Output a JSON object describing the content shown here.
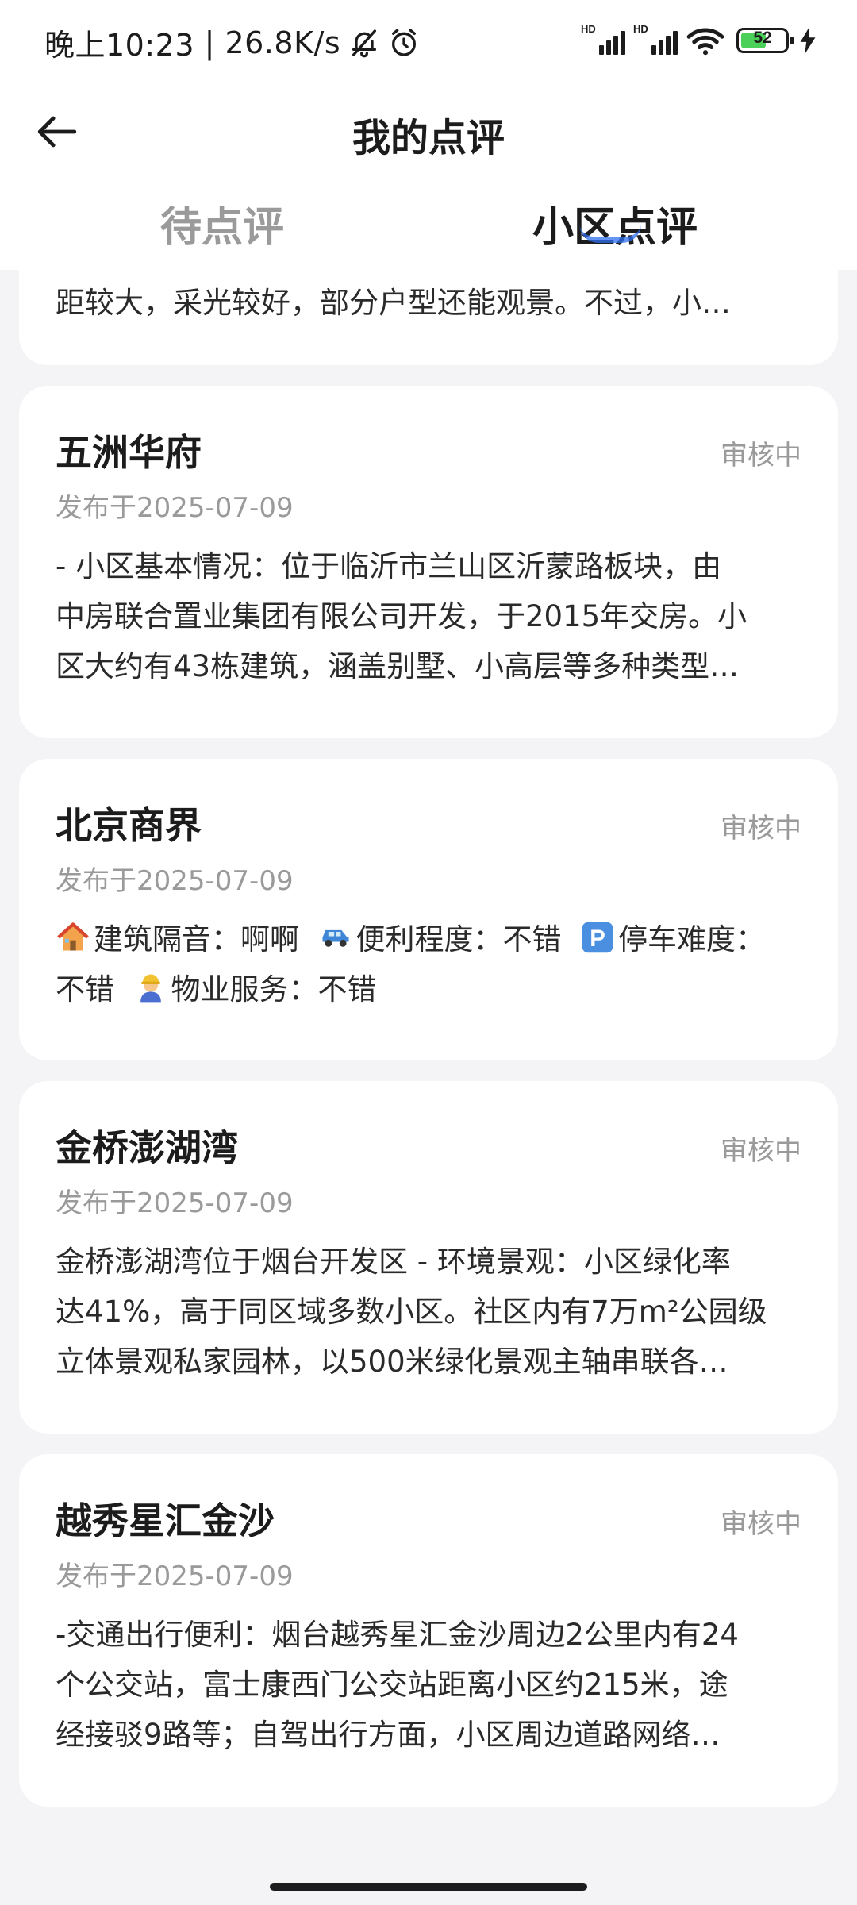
{
  "status_bar": {
    "time": "晚上10:23",
    "network_speed": "26.8K/s",
    "sim1_label": "HD",
    "sim2_label": "HD",
    "battery_level": "52",
    "icons": [
      "bell-off-icon",
      "alarm-clock-icon",
      "signal-icon",
      "wifi-icon",
      "battery-icon",
      "charging-icon"
    ]
  },
  "header": {
    "title": "我的点评",
    "back_icon": "arrow-left-icon"
  },
  "tabs": [
    {
      "label": "待点评",
      "active": false
    },
    {
      "label": "小区点评",
      "active": true
    }
  ],
  "colors": {
    "accent": "#2f6ff0",
    "background": "#f4f4f6",
    "card": "#ffffff",
    "muted": "#9a9a9a",
    "text": "#1c1c1c"
  },
  "partial_card": {
    "excerpt": "距较大，采光较好，部分户型还能观景。不过，小…"
  },
  "reviews": [
    {
      "title": "五洲华府",
      "status": "审核中",
      "date": "发布于2025-07-09",
      "lines": [
        "- 小区基本情况：位于临沂市兰山区沂蒙路板块，由",
        "中房联合置业集团有限公司开发，于2015年交房。小",
        "区大约有43栋建筑，涵盖别墅、小高层等多种类型…"
      ]
    },
    {
      "title": "北京商界",
      "status": "审核中",
      "date": "发布于2025-07-09",
      "tags": [
        {
          "icon": "house-icon",
          "label": "建筑隔音：",
          "value": "啊啊"
        },
        {
          "icon": "car-icon",
          "label": "便利程度：",
          "value": "不错"
        },
        {
          "icon": "parking-icon",
          "label": "停车难度：",
          "value": "不错"
        },
        {
          "icon": "worker-icon",
          "label": "物业服务：",
          "value": "不错"
        }
      ]
    },
    {
      "title": "金桥澎湖湾",
      "status": "审核中",
      "date": "发布于2025-07-09",
      "lines": [
        "金桥澎湖湾位于烟台开发区 - 环境景观：小区绿化率",
        "达41%，高于同区域多数小区。社区内有7万m²公园级",
        "立体景观私家园林，以500米绿化景观主轴串联各…"
      ]
    },
    {
      "title": "越秀星汇金沙",
      "status": "审核中",
      "date": "发布于2025-07-09",
      "lines": [
        "-交通出行便利：烟台越秀星汇金沙周边2公里内有24",
        "个公交站，富士康西门公交站距离小区约215米，途",
        "经接驳9路等；自驾出行方面，小区周边道路网络…"
      ]
    }
  ]
}
